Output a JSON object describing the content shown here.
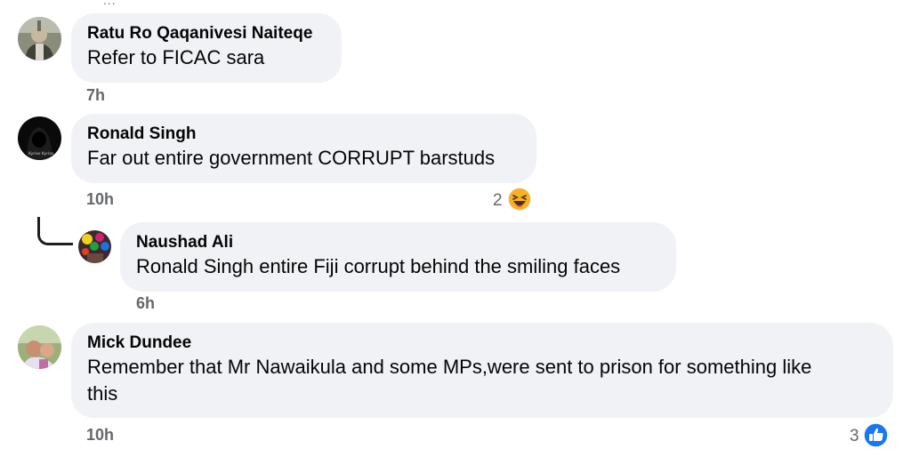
{
  "top_more_indicator": "...",
  "comments": [
    {
      "author": "Ratu Ro Qaqanivesi Naiteqe",
      "text": "Refer to FICAC sara",
      "time": "7h"
    },
    {
      "author": "Ronald Singh",
      "text": "Far out entire government CORRUPT barstuds",
      "time": "10h",
      "reaction_count": "2",
      "reaction_icon": "haha-emoji-icon",
      "avatar_caption": "Kyrios Kyrios"
    },
    {
      "author": "Naushad Ali",
      "text": "Ronald Singh entire Fiji corrupt behind the smiling faces",
      "time": "6h",
      "is_reply": true
    },
    {
      "author": "Mick Dundee",
      "text_line1": "Remember that Mr Nawaikula and some MPs,were sent to prison for something like",
      "text_line2": "this",
      "time": "10h",
      "reaction_count": "3",
      "reaction_icon": "like-thumb-icon"
    }
  ],
  "colors": {
    "bubble": "#f0f2f5",
    "meta_text": "#65676b",
    "like_blue": "#1877f2",
    "haha_yellow": "#f7b125"
  }
}
